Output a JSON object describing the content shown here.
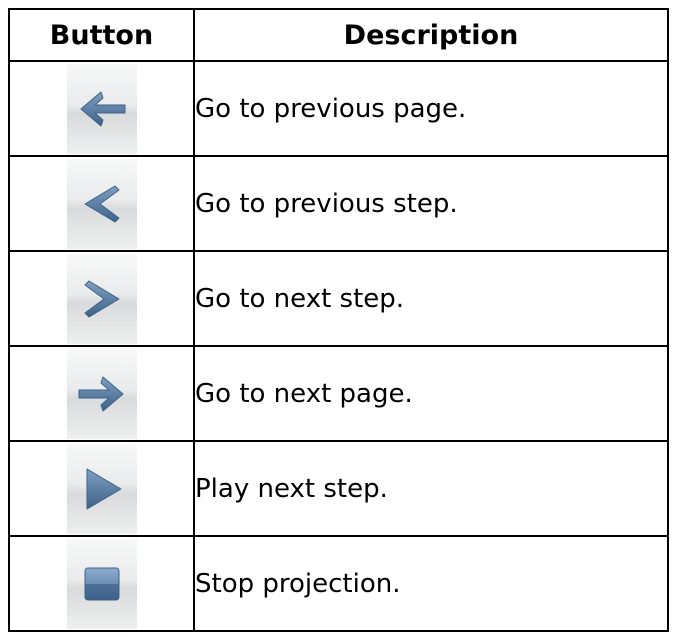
{
  "table": {
    "headers": {
      "button": "Button",
      "description": "Description"
    },
    "rows": [
      {
        "icon": "arrow-left-icon",
        "description": "Go to previous page."
      },
      {
        "icon": "chevron-left-icon",
        "description": "Go to previous step."
      },
      {
        "icon": "chevron-right-icon",
        "description": "Go to next step."
      },
      {
        "icon": "arrow-right-icon",
        "description": "Go to next page."
      },
      {
        "icon": "play-icon",
        "description": "Play next step."
      },
      {
        "icon": "stop-icon",
        "description": "Stop projection."
      }
    ]
  },
  "colors": {
    "icon_fill": "#5b7fa5",
    "icon_dark": "#3e6188"
  }
}
